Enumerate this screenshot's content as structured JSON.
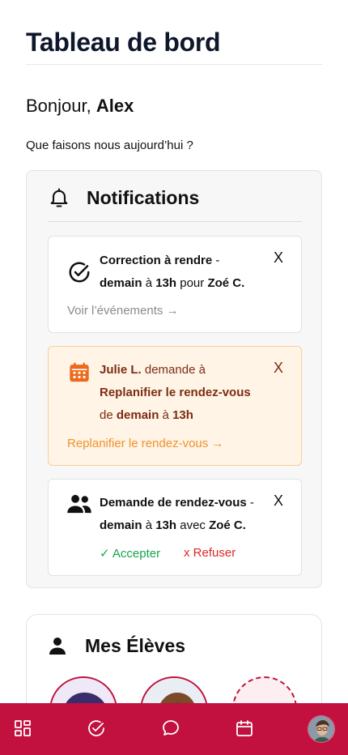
{
  "header": {
    "title": "Tableau de bord"
  },
  "greeting": {
    "prefix": "Bonjour,",
    "name": "Alex",
    "question": "Que faisons nous aujourd’hui ?"
  },
  "notifications": {
    "title": "Notifications",
    "close_label": "X",
    "items": [
      {
        "icon": "check-circle-icon",
        "title": "Correction à rendre",
        "sep": "-",
        "day": "demain",
        "at": "à",
        "time": "13h",
        "for": "pour",
        "student": "Zoé C.",
        "link": "Voir l’événements →"
      },
      {
        "icon": "calendar-icon",
        "person": "Julie L.",
        "asks": "demande à",
        "action": "Replanifier le rendez-vous",
        "of": "de",
        "day": "demain",
        "at": "à",
        "time": "13h",
        "link": "Replanifier le rendez-vous →"
      },
      {
        "icon": "group-icon",
        "title": "Demande de rendez-vous",
        "sep": "-",
        "day": "demain",
        "at": "à",
        "time": "13h",
        "with": "avec",
        "student": "Zoé C.",
        "accept": "✓ Accepter",
        "refuse": "x Refuser"
      }
    ]
  },
  "students": {
    "title": "Mes Élèves",
    "avatars": [
      "student-avatar-1",
      "student-avatar-2"
    ],
    "add": "add-student"
  },
  "nav": {
    "items": [
      "dashboard-icon",
      "tasks-icon",
      "messages-icon",
      "calendar-icon",
      "profile-avatar"
    ],
    "color": "#c2103f"
  },
  "colors": {
    "accent": "#c2103f",
    "warning_bg": "#fff4e6",
    "warning_text": "#7c2d12",
    "warning_link": "#f0922a",
    "success": "#16a34a",
    "danger": "#dc2626"
  }
}
